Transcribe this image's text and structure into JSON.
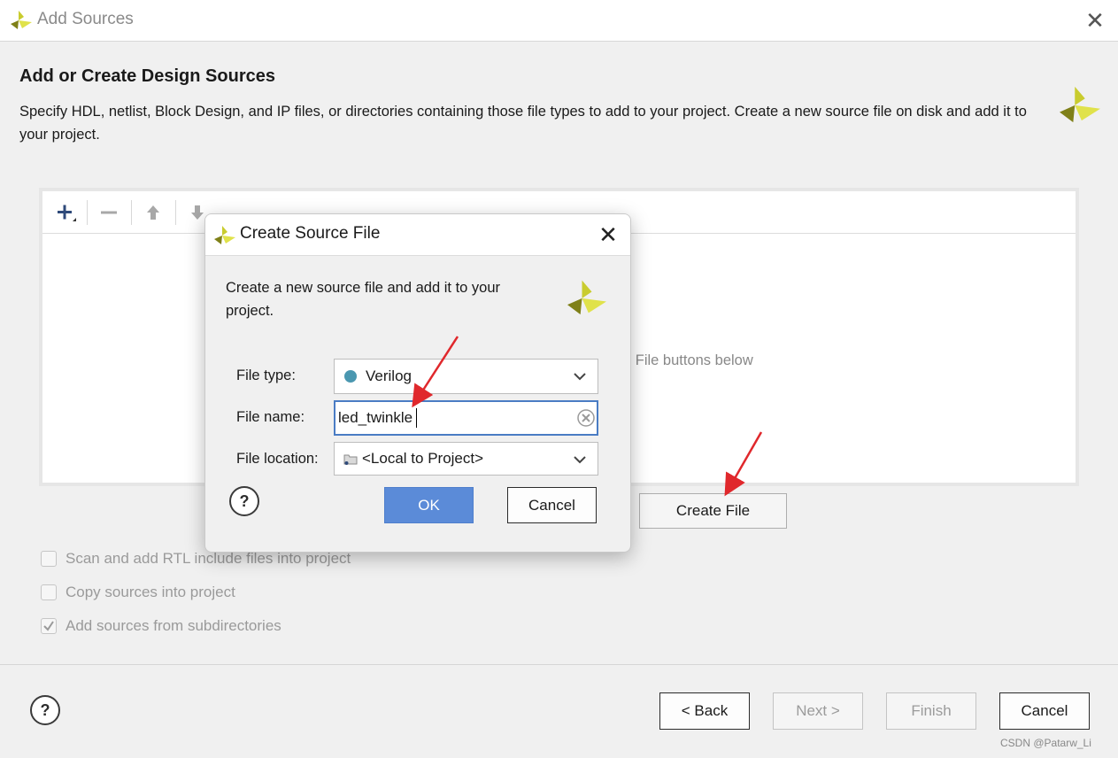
{
  "window": {
    "title": "Add Sources",
    "heading": "Add or Create Design Sources",
    "description": "Specify HDL, netlist, Block Design, and IP files, or directories containing those file types to add to your project. Create a new source file on disk and add it to your project."
  },
  "sources_panel": {
    "hint_partial": "e File buttons below",
    "toolbar": [
      "add-icon",
      "remove-icon",
      "move-up-icon",
      "move-down-icon"
    ]
  },
  "buttons": {
    "create_file": "Create File"
  },
  "options": [
    {
      "label": "Scan and add RTL include files into project",
      "checked": false
    },
    {
      "label": "Copy sources into project",
      "checked": false
    },
    {
      "label": "Add sources from subdirectories",
      "checked": true
    }
  ],
  "footer": {
    "help": "?",
    "back": "< Back",
    "next": "Next >",
    "finish": "Finish",
    "cancel": "Cancel"
  },
  "dialog": {
    "title": "Create Source File",
    "description": "Create a new source file and add it to your project.",
    "file_type_label": "File type:",
    "file_type_value": "Verilog",
    "file_name_label": "File name:",
    "file_name_value": "led_twinkle",
    "file_location_label": "File location:",
    "file_location_value": "<Local to Project>",
    "help": "?",
    "ok": "OK",
    "cancel": "Cancel"
  },
  "watermark": "CSDN @Patarw_Li",
  "colors": {
    "accent": "#5b8bd8",
    "logo_yellow": "#d7d93a",
    "logo_olive": "#8a8a1e",
    "verilog_dot": "#4a97b0",
    "annotation_arrow": "#e0282c"
  }
}
